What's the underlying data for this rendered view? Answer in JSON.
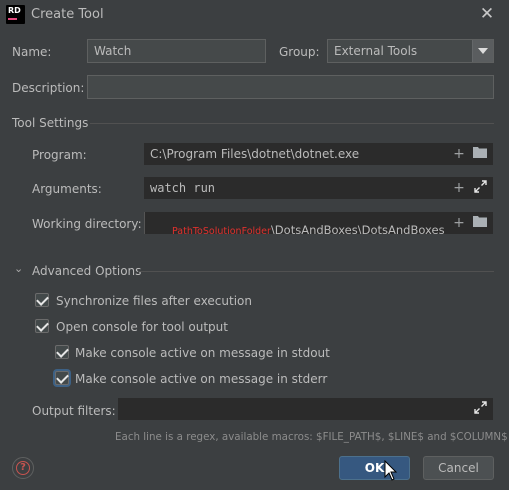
{
  "window": {
    "logo_text": "RD",
    "title": "Create Tool",
    "close_glyph": "✕"
  },
  "name_field": {
    "label": "Name:",
    "value": "Watch"
  },
  "group_field": {
    "label": "Group:",
    "value": "External Tools"
  },
  "description_field": {
    "label": "Description:",
    "value": ""
  },
  "tool_settings": {
    "heading": "Tool Settings",
    "program": {
      "label": "Program:",
      "value": "C:\\Program Files\\dotnet\\dotnet.exe",
      "icons": [
        "+",
        "folder-icon"
      ]
    },
    "arguments": {
      "label": "Arguments:",
      "value": "watch run",
      "icons": [
        "+",
        "expand-icon"
      ]
    },
    "working_directory": {
      "label": "Working directory:",
      "value_prefix": "PathToSolutionFolder",
      "value_suffix": "\\DotsAndBoxes\\DotsAndBoxes",
      "icons": [
        "+",
        "folder-icon"
      ]
    }
  },
  "advanced": {
    "heading": "Advanced Options",
    "toggle_glyph": "⌄",
    "options": [
      {
        "label": "Synchronize files after execution",
        "checked": true
      },
      {
        "label": "Open console for tool output",
        "checked": true
      },
      {
        "label": "Make console active on message in stdout",
        "checked": true
      },
      {
        "label": "Make console active on message in stderr",
        "checked": true
      }
    ],
    "output_filters": {
      "label": "Output filters:",
      "value": ""
    },
    "hint": "Each line is a regex, available macros: $FILE_PATH$, $LINE$ and $COLUMN$"
  },
  "buttons": {
    "help_glyph": "?",
    "ok_label": "OK",
    "cancel_label": "Cancel"
  },
  "colors": {
    "background": "#3c3f41",
    "input_background": "#45494a",
    "primary_button": "#365880",
    "macro_red": "#e0312d"
  }
}
